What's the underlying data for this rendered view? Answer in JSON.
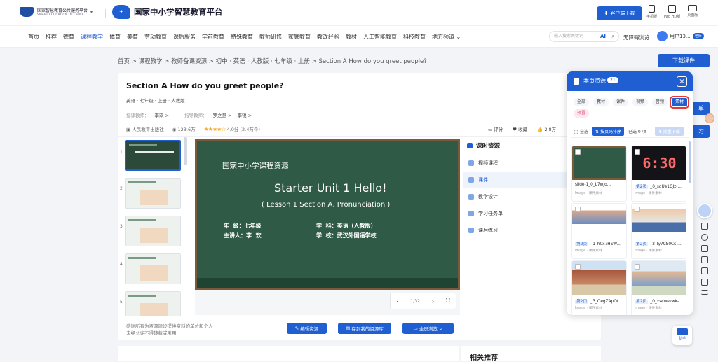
{
  "header": {
    "platform_line1": "国家智慧教育公共服务平台",
    "platform_line2": "SMART EDUCATION OF CHINA",
    "site_title": "国家中小学智慧教育平台",
    "client_download": "客户端下载",
    "devices": [
      "手机版",
      "Pad HD版",
      "桌面版"
    ]
  },
  "nav": {
    "items": [
      "首页",
      "推荐",
      "德育",
      "课程教学",
      "体育",
      "美育",
      "劳动教育",
      "课后服务",
      "学前教育",
      "特殊教育",
      "教师研修",
      "家庭教育",
      "教改经验",
      "教材",
      "人工智能教育",
      "科技教育",
      "地方频道"
    ],
    "active_index": 3,
    "search_placeholder": "输入搜索关键词",
    "search_ai": "AI",
    "barrier_free": "无障碍浏览",
    "user_name": "用户13...",
    "user_badge": "老师"
  },
  "breadcrumb": "首页 > 课程教学 > 教师备课资源 > 初中 · 英语 · 人教版 · 七年级 · 上册 > Section A How do you greet people?",
  "download_course": "下载课件",
  "side_tabs": [
    "单",
    "习"
  ],
  "resource": {
    "title": "Section A How do you greet people?",
    "subtitle": "英语 · 七年级 · 上册 · 人教版",
    "lecturer_label": "授课教师：",
    "lecturer": "李欢 >",
    "guide_label": "指导教师：",
    "guides": [
      "罗之慧 >",
      "李锐 >"
    ],
    "publisher": "人民教育出版社",
    "views": "123.6万",
    "rating": "4.0分",
    "rating_count": "(2.4万个)",
    "rating_value": 4,
    "rating_max": 5,
    "actions": [
      "评分",
      "收藏",
      "2.8万"
    ]
  },
  "thumbnails": [
    "1",
    "2",
    "3",
    "4",
    "5"
  ],
  "slide": {
    "brand": "国家中小学课程资源",
    "title": "Starter Unit 1 Hello!",
    "lesson": "( Lesson 1 Section A, Pronunciation )",
    "left_info": "年  级：七年级\n主讲人：李  欢",
    "right_info": "学  科：英语（人教版）\n学  校：武汉外国语学校",
    "page": "1/32"
  },
  "lesson_panel": {
    "title": "课时资源",
    "items": [
      "视频课程",
      "课件",
      "教学设计",
      "学习任务单",
      "课后练习"
    ],
    "active_index": 1
  },
  "note": "感谢所有为资源建设提供资料的单位和个人\n未经允许不得转载或引用",
  "buttons": {
    "edit": "编辑资源",
    "save": "存到我的资源库",
    "fullscreen": "全屏浏览"
  },
  "related": "相关推荐",
  "drawer": {
    "title": "本页资源",
    "count": "21",
    "close": "×",
    "filters": [
      "全部",
      "教材",
      "课件",
      "视频",
      "音频",
      "素材",
      "预置"
    ],
    "active_filter": 5,
    "select_all": "全选",
    "sort": "按页码排序",
    "selected": "已选 0 项",
    "batch_download": "批量下载",
    "cards": [
      {
        "tag": "",
        "name": "slide-1_0_L7wJo...",
        "kind": "Image · 课件素材"
      },
      {
        "tag": "第2页",
        "name": "_0_sdUe1OJz-...",
        "kind": "Image · 课件素材"
      },
      {
        "tag": "第2页",
        "name": "_1_h0x7HSW...",
        "kind": "Image · 课件素材"
      },
      {
        "tag": "第2页",
        "name": "_2_Iy7CS0Cs-...",
        "kind": "Image · 课件素材"
      },
      {
        "tag": "第2页",
        "name": "_3_OegZApQf...",
        "kind": "Image · 课件素材"
      },
      {
        "tag": "第2页",
        "name": "_0_xwlwezwk-...",
        "kind": "Image · 课件素材"
      }
    ],
    "card1_text": "6:30"
  },
  "helper": "助手",
  "colors": {
    "primary": "#1f5fd1",
    "chalkboard": "#2f5a45",
    "highlight": "#e53935",
    "star": "#f5a623"
  }
}
